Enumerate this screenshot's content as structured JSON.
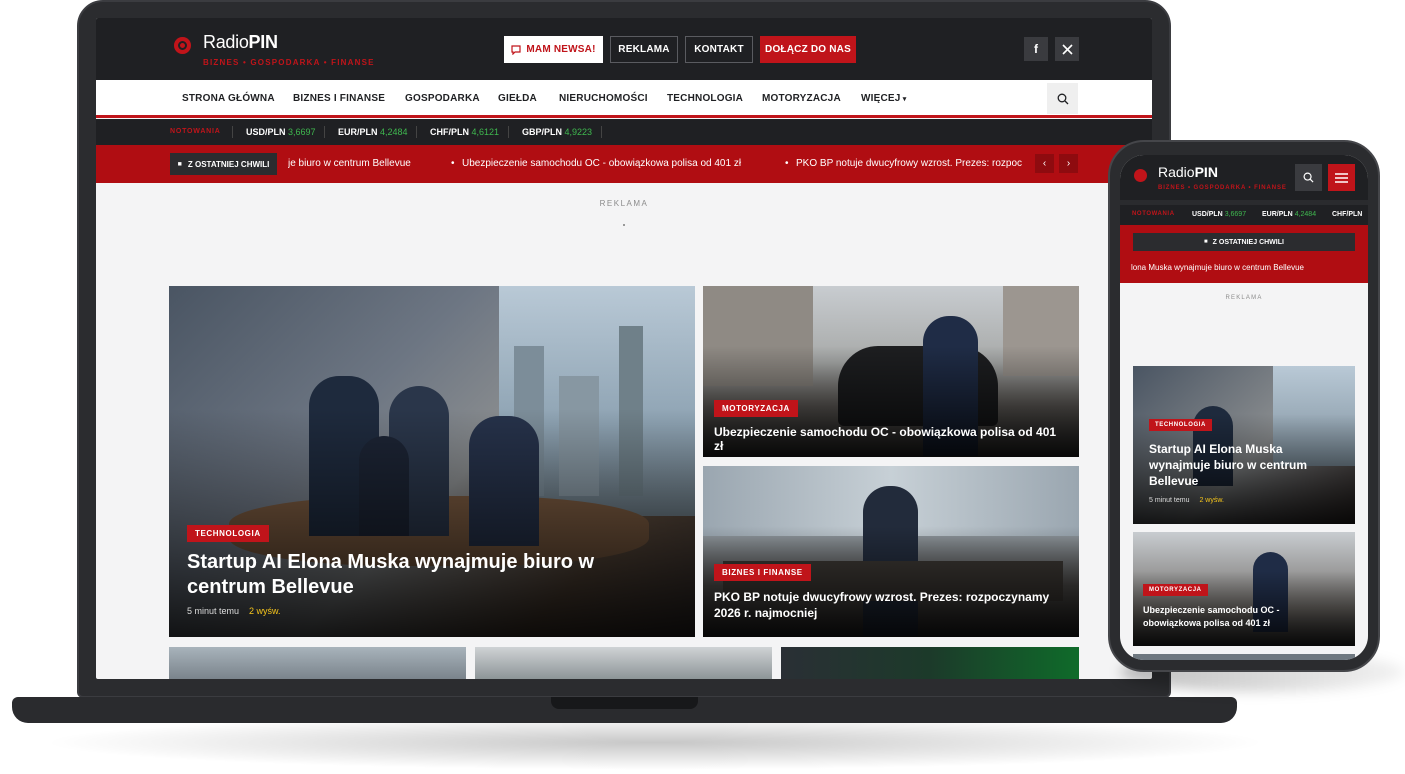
{
  "brand": {
    "name_light": "Radio",
    "name_bold": "PIN",
    "tagline": "BIZNES • GOSPODARKA • FINANSE"
  },
  "header": {
    "btn_news": "MAM NEWSA!",
    "btn_ad": "REKLAMA",
    "btn_contact": "KONTAKT",
    "btn_join": "DOŁĄCZ DO NAS",
    "social": [
      "facebook-icon",
      "x-icon"
    ]
  },
  "nav": [
    "STRONA GŁÓWNA",
    "BIZNES I FINANSE",
    "GOSPODARKA",
    "GIEŁDA",
    "NIERUCHOMOŚCI",
    "TECHNOLOGIA",
    "MOTORYZACJA",
    "WIĘCEJ"
  ],
  "quotes": {
    "label": "NOTOWANIA",
    "items": [
      {
        "pair": "USD/PLN",
        "value": "3,6697"
      },
      {
        "pair": "EUR/PLN",
        "value": "4,2484"
      },
      {
        "pair": "CHF/PLN",
        "value": "4,6121"
      },
      {
        "pair": "GBP/PLN",
        "value": "4,9223"
      }
    ]
  },
  "ticker": {
    "label": "Z OSTATNIEJ CHWILI",
    "items": [
      "je biuro w centrum Bellevue",
      "Ubezpieczenie samochodu OC - obowiązkowa polisa od 401 zł",
      "PKO BP notuje dwucyfrowy wzrost. Prezes: rozpoc"
    ],
    "prev": "‹",
    "next": "›"
  },
  "ad_label": "REKLAMA",
  "articles": {
    "main": {
      "category": "TECHNOLOGIA",
      "title": "Startup AI Elona Muska wynajmuje biuro w centrum Bellevue",
      "time": "5 minut temu",
      "views": "2 wyśw."
    },
    "moto": {
      "category": "MOTORYZACJA",
      "title": "Ubezpieczenie samochodu OC - obowiązkowa polisa od 401 zł"
    },
    "biz": {
      "category": "BIZNES I FINANSE",
      "title": "PKO BP notuje dwucyfrowy wzrost. Prezes: rozpoczynamy 2026 r. najmocniej"
    }
  },
  "phone": {
    "quotes": [
      {
        "pair": "USD/PLN",
        "value": "3,6697"
      },
      {
        "pair": "EUR/PLN",
        "value": "4,2484"
      },
      {
        "pair": "CHF/PLN",
        "value": ""
      }
    ],
    "ticker_text": "lona Muska wynajmuje biuro w centrum Bellevue",
    "main": {
      "category": "TECHNOLOGIA",
      "title": "Startup AI Elona Muska wynajmuje biuro w centrum Bellevue",
      "time": "5 minut temu",
      "views": "2 wyśw."
    },
    "moto": {
      "category": "MOTORYZACJA",
      "title": "Ubezpieczenie samochodu OC - obowiązkowa polisa od 401 zł"
    }
  },
  "colors": {
    "accent": "#c0141a",
    "dark": "#1f2023",
    "positive": "#3fb84f",
    "views": "#f6c51b"
  }
}
